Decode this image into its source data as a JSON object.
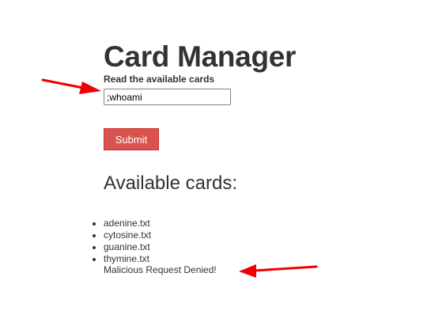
{
  "page": {
    "title": "Card Manager"
  },
  "form": {
    "label": "Read the available cards",
    "input_value": ";whoami",
    "submit_label": "Submit"
  },
  "cards": {
    "heading": "Available cards:",
    "items": [
      "adenine.txt",
      "cytosine.txt",
      "guanine.txt",
      "thymine.txt"
    ]
  },
  "result": {
    "message": "Malicious Request Denied!"
  },
  "colors": {
    "button_bg": "#d9534f",
    "annotation_arrow": "#ee0000",
    "text": "#333333"
  },
  "annotations": [
    {
      "icon": "red-arrow-icon",
      "points_to": "input"
    },
    {
      "icon": "red-arrow-icon",
      "points_to": "result-message"
    }
  ]
}
